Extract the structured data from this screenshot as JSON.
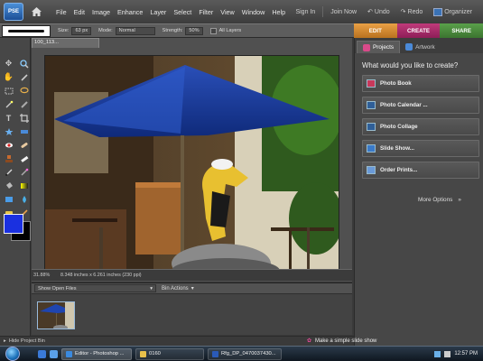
{
  "app": {
    "logo_label": "PSE"
  },
  "menu": {
    "items": [
      "File",
      "Edit",
      "Image",
      "Enhance",
      "Layer",
      "Select",
      "Filter",
      "View",
      "Window",
      "Help"
    ],
    "sign_in": "Sign In",
    "join_now": "Join Now",
    "undo": "Undo",
    "redo": "Redo",
    "organizer": "Organizer"
  },
  "options": {
    "size_label": "Size:",
    "size_value": "63 px",
    "mode_label": "Mode:",
    "mode_value": "Normal",
    "strength_label": "Strength:",
    "strength_value": "50%",
    "all_layers_label": "All Layers"
  },
  "mode_tabs": {
    "edit": "EDIT",
    "create": "CREATE",
    "share": "SHARE"
  },
  "document": {
    "tab_title": "100_113...",
    "zoom": "31.88%",
    "info": "8.348 inches x 6.261 inches (230 ppi)"
  },
  "bin": {
    "show_label": "Show Open Files",
    "actions_label": "Bin Actions"
  },
  "hide_bin_label": "Hide Project Bin",
  "panel": {
    "tabs": {
      "projects": "Projects",
      "artwork": "Artwork"
    },
    "heading": "What would you like to create?",
    "buttons": [
      "Photo Book",
      "Photo Calendar ...",
      "Photo Collage",
      "Slide Show...",
      "Order Prints..."
    ],
    "more_options": "More Options"
  },
  "tip": "Make a simple slide show",
  "taskbar": {
    "tasks": [
      "Editor - Photoshop ...",
      "0160",
      "Rfg_DP_0470037430..."
    ],
    "clock": "12:57 PM"
  },
  "colors": {
    "foreground": "#1a30e0",
    "background": "#000000",
    "edit_tab": "#d48a30",
    "create_tab": "#b02f6c",
    "share_tab": "#4e8f40"
  }
}
